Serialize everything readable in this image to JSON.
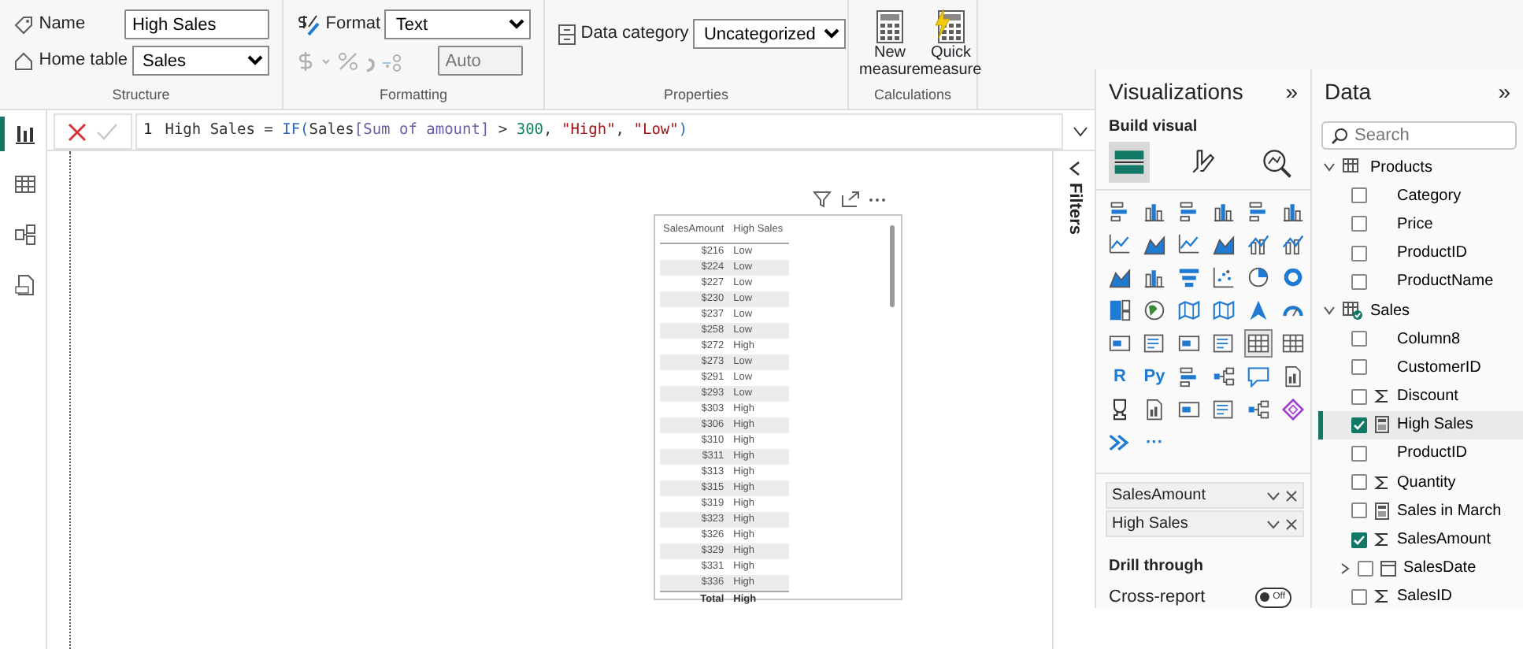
{
  "ribbon": {
    "groups": [
      {
        "kind": "structure",
        "caption": "Structure",
        "name_label": "Name",
        "name_value": "High Sales",
        "table_label": "Home table",
        "table_value": "Sales"
      },
      {
        "kind": "formatting",
        "caption": "Formatting",
        "format_label": "Format",
        "format_value": "Text",
        "decimals_placeholder": "Auto",
        "disabled": true
      },
      {
        "kind": "properties",
        "caption": "Properties",
        "category_label": "Data category",
        "category_value": "Uncategorized"
      },
      {
        "kind": "calculations",
        "caption": "Calculations",
        "buttons": [
          {
            "kind": "new",
            "label": "New measure"
          },
          {
            "kind": "quick",
            "label": "Quick measure"
          }
        ]
      }
    ]
  },
  "nav": [
    {
      "kind": "report",
      "selected": true
    },
    {
      "kind": "table",
      "selected": false
    },
    {
      "kind": "model",
      "selected": false
    },
    {
      "kind": "dax",
      "selected": false
    }
  ],
  "formula": {
    "line": "1",
    "tokens": [
      {
        "kind": "plain",
        "text": "High Sales = "
      },
      {
        "kind": "function",
        "text": "IF("
      },
      {
        "kind": "plain",
        "text": "Sales"
      },
      {
        "kind": "column",
        "text": "[Sum of amount]"
      },
      {
        "kind": "plain",
        "text": " > "
      },
      {
        "kind": "number",
        "text": "300"
      },
      {
        "kind": "plain",
        "text": ", "
      },
      {
        "kind": "string",
        "text": "\"High\""
      },
      {
        "kind": "plain",
        "text": ", "
      },
      {
        "kind": "string",
        "text": "\"Low\""
      },
      {
        "kind": "function",
        "text": ")"
      }
    ]
  },
  "table_visual": {
    "columns": [
      "SalesAmount",
      "High Sales"
    ],
    "rows": [
      [
        "$216",
        "Low"
      ],
      [
        "$224",
        "Low"
      ],
      [
        "$227",
        "Low"
      ],
      [
        "$230",
        "Low"
      ],
      [
        "$237",
        "Low"
      ],
      [
        "$258",
        "Low"
      ],
      [
        "$272",
        "High"
      ],
      [
        "$273",
        "Low"
      ],
      [
        "$291",
        "Low"
      ],
      [
        "$293",
        "Low"
      ],
      [
        "$303",
        "High"
      ],
      [
        "$306",
        "High"
      ],
      [
        "$310",
        "High"
      ],
      [
        "$311",
        "High"
      ],
      [
        "$313",
        "High"
      ],
      [
        "$315",
        "High"
      ],
      [
        "$319",
        "High"
      ],
      [
        "$323",
        "High"
      ],
      [
        "$326",
        "High"
      ],
      [
        "$329",
        "High"
      ],
      [
        "$331",
        "High"
      ],
      [
        "$336",
        "High"
      ]
    ],
    "total": [
      "Total",
      "High"
    ]
  },
  "filters": {
    "label": "Filters"
  },
  "visualizations": {
    "title": "Visualizations",
    "collapse": "»",
    "subtitle": "Build visual",
    "tabs": [
      {
        "kind": "fields",
        "selected": true
      },
      {
        "kind": "format",
        "selected": false
      },
      {
        "kind": "analytics",
        "selected": false
      }
    ],
    "gallery": [
      {
        "kind": "hbar",
        "selected": false
      },
      {
        "kind": "vbar",
        "selected": false
      },
      {
        "kind": "hbar",
        "selected": false
      },
      {
        "kind": "vbar",
        "selected": false
      },
      {
        "kind": "hbar",
        "selected": false
      },
      {
        "kind": "vbar",
        "selected": false
      },
      {
        "kind": "line",
        "selected": false
      },
      {
        "kind": "area",
        "selected": false
      },
      {
        "kind": "line",
        "selected": false
      },
      {
        "kind": "area",
        "selected": false
      },
      {
        "kind": "combo",
        "selected": false
      },
      {
        "kind": "combo",
        "selected": false
      },
      {
        "kind": "area",
        "selected": false
      },
      {
        "kind": "vbar",
        "selected": false
      },
      {
        "kind": "funnel",
        "selected": false
      },
      {
        "kind": "scatter",
        "selected": false
      },
      {
        "kind": "pie",
        "selected": false
      },
      {
        "kind": "donut",
        "selected": false
      },
      {
        "kind": "treemap",
        "selected": false
      },
      {
        "kind": "globe",
        "selected": false
      },
      {
        "kind": "map",
        "selected": false
      },
      {
        "kind": "map",
        "selected": false
      },
      {
        "kind": "arrow",
        "selected": false
      },
      {
        "kind": "gauge",
        "selected": false
      },
      {
        "kind": "card",
        "selected": false
      },
      {
        "kind": "list",
        "selected": false
      },
      {
        "kind": "card",
        "selected": false
      },
      {
        "kind": "list",
        "selected": false
      },
      {
        "kind": "grid",
        "selected": true
      },
      {
        "kind": "grid",
        "selected": false
      },
      {
        "kind": "text",
        "label": "R",
        "selected": false
      },
      {
        "kind": "text",
        "label": "Py",
        "selected": false
      },
      {
        "kind": "hbar",
        "selected": false
      },
      {
        "kind": "tree",
        "selected": false
      },
      {
        "kind": "speech",
        "selected": false
      },
      {
        "kind": "doc",
        "selected": false
      },
      {
        "kind": "trophy",
        "selected": false
      },
      {
        "kind": "doc",
        "selected": false
      },
      {
        "kind": "card",
        "selected": false
      },
      {
        "kind": "list",
        "selected": false
      },
      {
        "kind": "tree",
        "selected": false
      },
      {
        "kind": "diamond",
        "selected": false
      },
      {
        "kind": "chevrons",
        "selected": false
      },
      {
        "kind": "text",
        "label": "···",
        "selected": false
      }
    ],
    "wells": [
      {
        "label": "SalesAmount"
      },
      {
        "label": "High Sales"
      }
    ],
    "drill": {
      "title": "Drill through",
      "toggle_label": "Cross-report",
      "on": false,
      "toggle_text": "Off"
    }
  },
  "data": {
    "title": "Data",
    "collapse": "»",
    "search": {
      "placeholder": "Search"
    },
    "tables": [
      {
        "name": "Products",
        "expanded": true,
        "checked": false,
        "fields": [
          {
            "name": "Category",
            "kind": "plain",
            "checked": false,
            "selected": false
          },
          {
            "name": "Price",
            "kind": "plain",
            "checked": false,
            "selected": false
          },
          {
            "name": "ProductID",
            "kind": "plain",
            "checked": false,
            "selected": false
          },
          {
            "name": "ProductName",
            "kind": "plain",
            "checked": false,
            "selected": false
          }
        ]
      },
      {
        "name": "Sales",
        "expanded": true,
        "checked": true,
        "fields": [
          {
            "name": "Column8",
            "kind": "plain",
            "checked": false,
            "selected": false
          },
          {
            "name": "CustomerID",
            "kind": "plain",
            "checked": false,
            "selected": false
          },
          {
            "name": "Discount",
            "kind": "sum",
            "checked": false,
            "selected": false
          },
          {
            "name": "High Sales",
            "kind": "measure",
            "checked": true,
            "selected": true
          },
          {
            "name": "ProductID",
            "kind": "plain",
            "checked": false,
            "selected": false
          },
          {
            "name": "Quantity",
            "kind": "sum",
            "checked": false,
            "selected": false
          },
          {
            "name": "Sales in March",
            "kind": "measure",
            "checked": false,
            "selected": false
          },
          {
            "name": "SalesAmount",
            "kind": "sum",
            "checked": true,
            "selected": false
          },
          {
            "name": "SalesDate",
            "kind": "date",
            "checked": false,
            "selected": false,
            "expanded": false
          },
          {
            "name": "SalesID",
            "kind": "sum",
            "checked": false,
            "selected": false
          }
        ]
      }
    ]
  }
}
